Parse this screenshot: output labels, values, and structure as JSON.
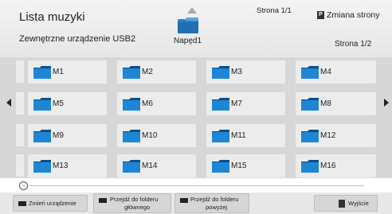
{
  "header": {
    "title": "Lista muzyki",
    "device": "Zewnętrzne urządzenie USB2",
    "drive_label": "Napęd1",
    "page_top": "Strona 1/1",
    "page_bottom": "Strona 1/2",
    "page_change_key": "P",
    "page_change_label": "Zmiana strony"
  },
  "folders": [
    {
      "label": "M1"
    },
    {
      "label": "M2"
    },
    {
      "label": "M3"
    },
    {
      "label": "M4"
    },
    {
      "label": "M5"
    },
    {
      "label": "M6"
    },
    {
      "label": "M7"
    },
    {
      "label": "M8"
    },
    {
      "label": "M9"
    },
    {
      "label": "M10"
    },
    {
      "label": "M11"
    },
    {
      "label": "M12"
    },
    {
      "label": "M13"
    },
    {
      "label": "M14"
    },
    {
      "label": "M15"
    },
    {
      "label": "M16"
    }
  ],
  "footer": {
    "change_device": "Zmień urządzenie",
    "main_folder_line1": "Przejdź do folderu",
    "main_folder_line2": "głównego",
    "up_folder_line1": "Przejdź do folderu",
    "up_folder_line2": "powyżej",
    "exit": "Wyjście"
  },
  "colors": {
    "folder_blue": "#1f86d6",
    "folder_dark": "#0b4f8a",
    "grid_bg": "#d7d7d7",
    "tile_bg": "#ececec"
  },
  "icons": {
    "folder": "folder-icon",
    "drive": "drive-icon",
    "up": "up-arrow-icon",
    "nav_left": "left-arrow-icon",
    "nav_right": "right-arrow-icon",
    "exit": "exit-icon"
  }
}
